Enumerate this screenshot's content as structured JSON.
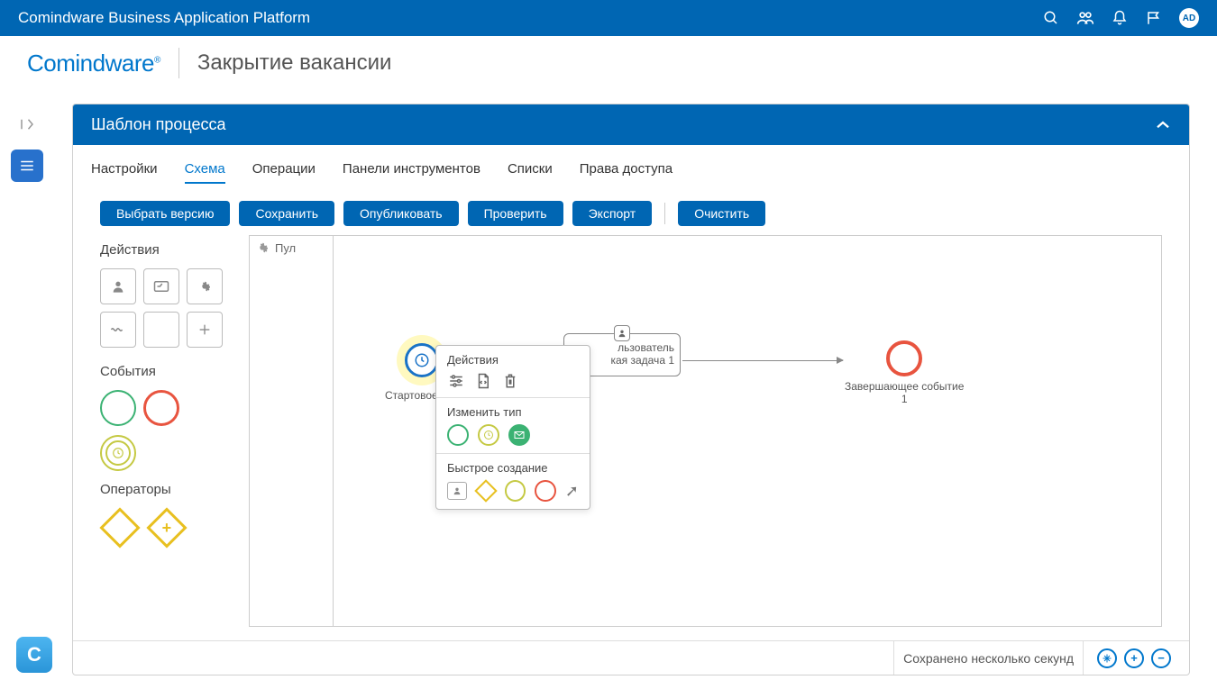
{
  "header": {
    "title": "Comindware Business Application Platform",
    "avatar_initials": "AD"
  },
  "logo": {
    "brand": "Comindware",
    "reg": "®",
    "page_title": "Закрытие вакансии"
  },
  "panel": {
    "title": "Шаблон процесса"
  },
  "tabs": [
    {
      "label": "Настройки",
      "active": false
    },
    {
      "label": "Схема",
      "active": true
    },
    {
      "label": "Операции",
      "active": false
    },
    {
      "label": "Панели инструментов",
      "active": false
    },
    {
      "label": "Списки",
      "active": false
    },
    {
      "label": "Права доступа",
      "active": false
    }
  ],
  "toolbar": {
    "select_version": "Выбрать версию",
    "save": "Сохранить",
    "publish": "Опубликовать",
    "validate": "Проверить",
    "export": "Экспорт",
    "clear": "Очистить"
  },
  "palette": {
    "actions_title": "Действия",
    "events_title": "События",
    "operators_title": "Операторы"
  },
  "canvas": {
    "pool_label": "Пул",
    "start_label": "Стартовое соб",
    "task_label_l1": "льзователь",
    "task_label_l2": "кая задача 1",
    "end_label_l1": "Завершающее событие",
    "end_label_l2": "1"
  },
  "popup": {
    "actions_title": "Действия",
    "change_type_title": "Изменить тип",
    "quick_create_title": "Быстрое создание"
  },
  "footer": {
    "save_status": "Сохранено несколько секунд"
  }
}
